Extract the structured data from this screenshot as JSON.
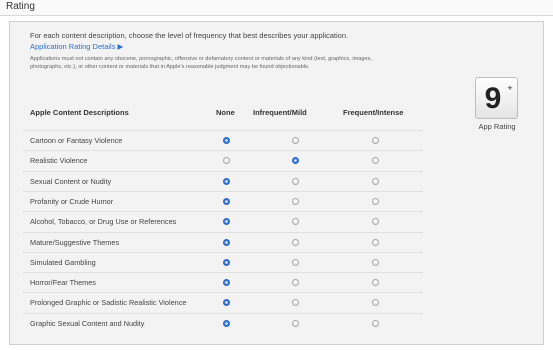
{
  "header": {
    "title": "Rating"
  },
  "intro": {
    "text": "For each content description, choose the level of frequency that best describes your application.",
    "details_link": "Application Rating Details ▶",
    "disclaimer": "Applications must not contain any obscene, pornographic, offensive or defamatory content or materials of any kind (text, graphics, images, photographs, etc.), or other content or materials that in Apple's reasonable judgment may be found objectionable."
  },
  "table": {
    "headers": [
      "Apple Content Descriptions",
      "None",
      "Infrequent/Mild",
      "Frequent/Intense"
    ],
    "rows": [
      {
        "label": "Cartoon or Fantasy Violence",
        "selected": "None"
      },
      {
        "label": "Realistic Violence",
        "selected": "Infrequent/Mild"
      },
      {
        "label": "Sexual Content or Nudity",
        "selected": "None"
      },
      {
        "label": "Profanity or Crude Humor",
        "selected": "None"
      },
      {
        "label": "Alcohol, Tobacco, or Drug Use or References",
        "selected": "None"
      },
      {
        "label": "Mature/Suggestive Themes",
        "selected": "None"
      },
      {
        "label": "Simulated Gambling",
        "selected": "None"
      },
      {
        "label": "Horror/Fear Themes",
        "selected": "None"
      },
      {
        "label": "Prolonged Graphic or Sadistic Realistic Violence",
        "selected": "None"
      },
      {
        "label": "Graphic Sexual Content and Nudity",
        "selected": "None"
      }
    ]
  },
  "rating": {
    "value": "9",
    "suffix": "+",
    "label": "App Rating"
  },
  "colors": {
    "accent": "#2a6fd0",
    "selected_radio": "#3d82e0"
  }
}
